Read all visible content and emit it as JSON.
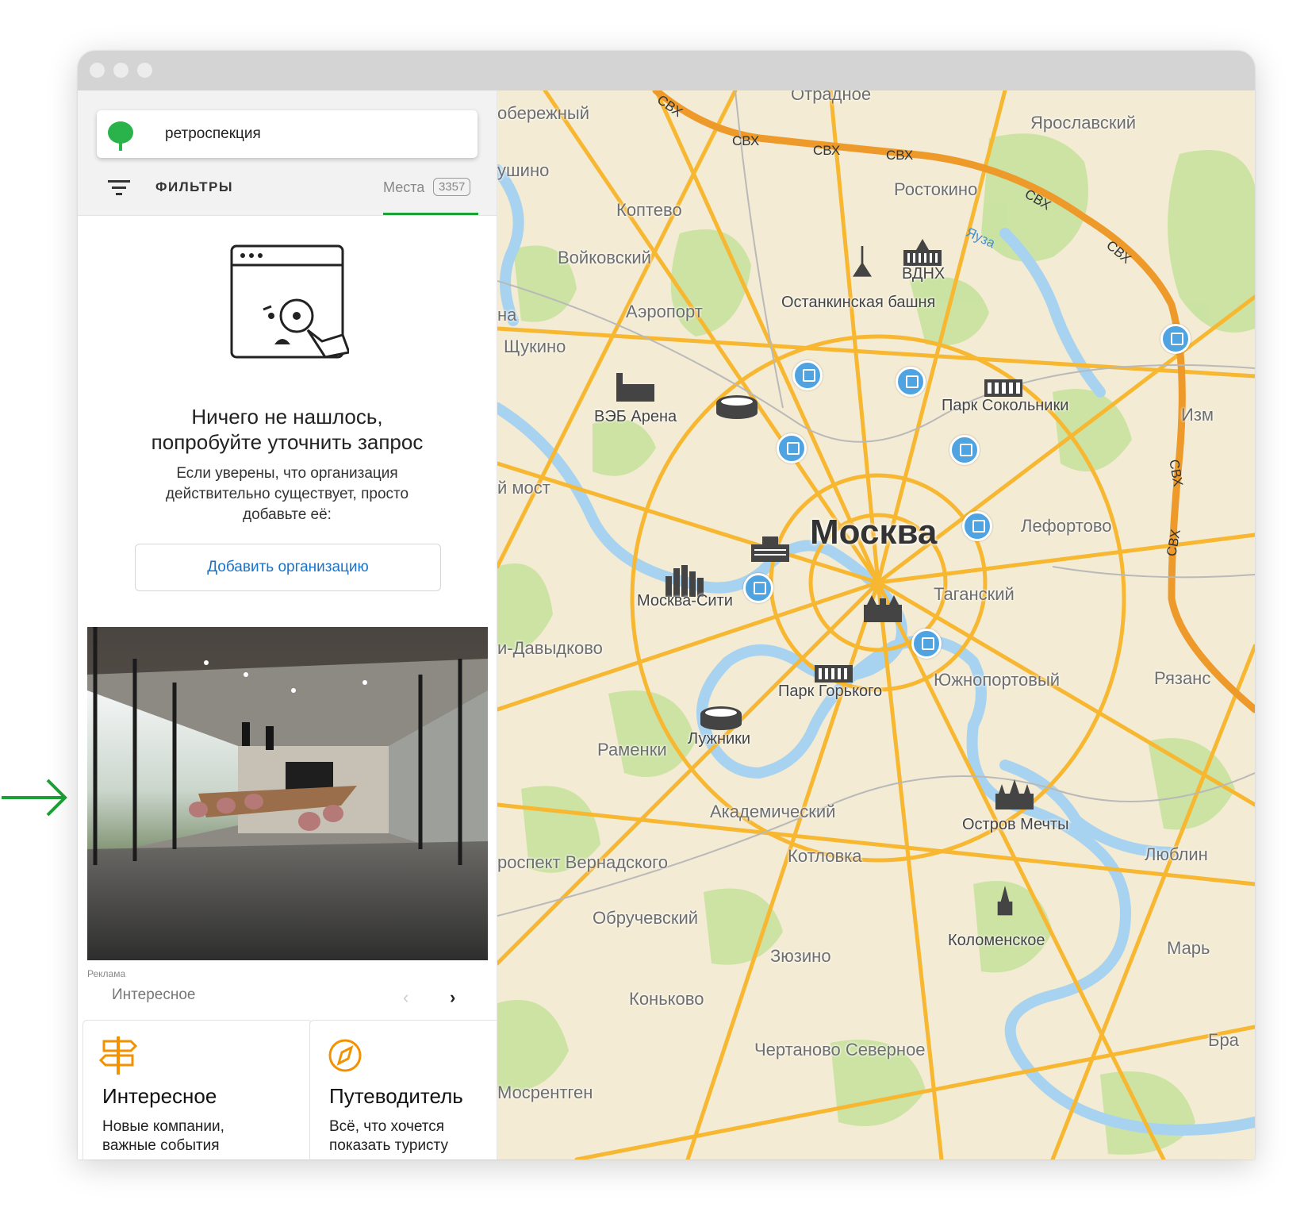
{
  "search": {
    "query": "ретроспекция"
  },
  "filters": {
    "label": "ФИЛЬТРЫ"
  },
  "places_tab": {
    "label": "Места",
    "count": "3357"
  },
  "empty_state": {
    "title_line1": "Ничего не нашлось,",
    "title_line2": "попробуйте уточнить запрос",
    "desc_line1": "Если уверены, что организация",
    "desc_line2": "действительно существует, просто",
    "desc_line3": "добавьте её:",
    "add_button": "Добавить организацию"
  },
  "ad": {
    "label": "Реклама"
  },
  "feed": {
    "title": "Интересное",
    "prev": "‹",
    "next": "›",
    "cards": [
      {
        "title": "Интересное",
        "line1": "Новые компании,",
        "line2": "важные события"
      },
      {
        "title": "Путеводитель",
        "line1": "Всё, что хочется",
        "line2": "показать туристу"
      }
    ]
  },
  "map": {
    "city": "Москва",
    "districts": [
      "Отрадное",
      "обережный",
      "Ярославский",
      "ушино",
      "Ростокино",
      "Коптево",
      "Войковский",
      "Аэропорт",
      "Щукино",
      "на",
      "й мост",
      "Лефортово",
      "Таганский",
      "и-Давыдково",
      "Южнопортовый",
      "Рязанс",
      "Раменки",
      "Академический",
      "Котловка",
      "Люблин",
      "роспект Вернадского",
      "Обручевский",
      "Марь",
      "Зюзино",
      "Коньково",
      "Бра",
      "Чертаново Северное",
      "Мосрентген",
      "Изм"
    ],
    "landmarks": [
      "ВДНХ",
      "Останкинская башня",
      "ВЭБ Арена",
      "Парк Сокольники",
      "Москва-Сити",
      "Парк Горького",
      "Лужники",
      "Остров Мечты",
      "Коломенское"
    ],
    "road": "СВХ",
    "river": "Яуза"
  },
  "colors": {
    "accent": "#1ba136",
    "link": "#1a73c9",
    "road": "#f7b731",
    "park": "#c9e3a0",
    "water": "#a8d3f0"
  }
}
